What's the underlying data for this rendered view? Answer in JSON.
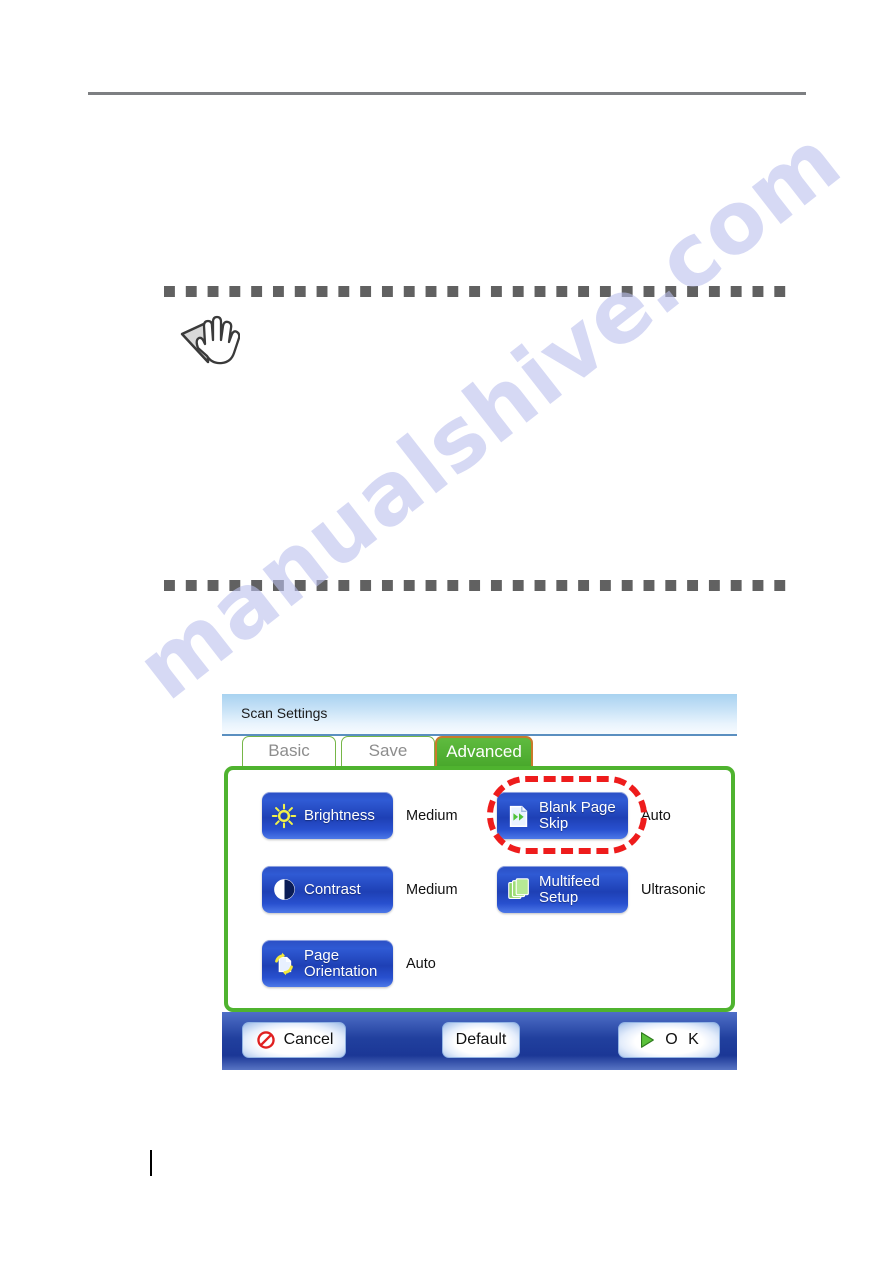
{
  "page": {
    "watermark": "manualshive.com",
    "note_icon": "hand-pointer-icon"
  },
  "dialog": {
    "header": {
      "title": "Scan Settings"
    },
    "tabs": [
      {
        "label": "Basic",
        "active": false,
        "name": "tab-basic"
      },
      {
        "label": "Save",
        "active": false,
        "name": "tab-save"
      },
      {
        "label": "Advanced",
        "active": true,
        "name": "tab-advanced"
      }
    ],
    "settings": [
      {
        "label_line1": "Brightness",
        "label_line2": "",
        "value": "Medium",
        "icon": "sun-icon",
        "highlighted": false
      },
      {
        "label_line1": "Contrast",
        "label_line2": "",
        "value": "Medium",
        "icon": "contrast-circle-icon",
        "highlighted": false
      },
      {
        "label_line1": "Page",
        "label_line2": "Orientation",
        "value": "Auto",
        "icon": "page-rotate-icon",
        "highlighted": false
      },
      {
        "label_line1": "Blank Page",
        "label_line2": "Skip",
        "value": "Auto",
        "icon": "page-skip-icon",
        "highlighted": true
      },
      {
        "label_line1": "Multifeed",
        "label_line2": "Setup",
        "value": "Ultrasonic",
        "icon": "stacked-pages-icon",
        "highlighted": false
      }
    ],
    "footer": {
      "cancel_label": "Cancel",
      "cancel_icon": "prohibition-icon",
      "default_label": "Default",
      "ok_label": "O K",
      "ok_icon": "play-triangle-icon"
    },
    "colors": {
      "accent_green": "#4fb32f",
      "active_tab_border": "#c97a2a",
      "button_blue": "#2850cf",
      "highlight_red": "#ee1c1c",
      "footer_blue": "#21409e"
    }
  }
}
